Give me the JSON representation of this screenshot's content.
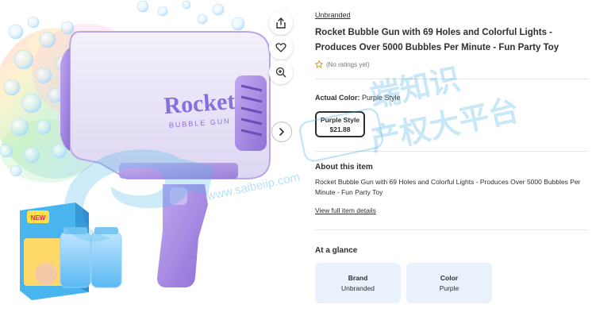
{
  "product": {
    "brand": "Unbranded",
    "title": "Rocket Bubble Gun with 69 Holes and Colorful Lights - Produces Over 5000 Bubbles Per Minute - Fun Party Toy",
    "rating_text": "(No ratings yet)",
    "printed_name": "Rocket",
    "printed_sub": "BUBBLE GUN",
    "box_badge": "NEW"
  },
  "color": {
    "label": "Actual Color:",
    "value": "Purple Style",
    "swatch_name": "Purple Style",
    "swatch_price": "$21.88"
  },
  "about": {
    "heading": "About this item",
    "text": "Rocket Bubble Gun with 69 Holes and Colorful Lights - Produces Over 5000 Bubbles Per Minute - Fun Party Toy",
    "link": "View full item details"
  },
  "glance": {
    "heading": "At a glance",
    "cards": [
      {
        "key": "Brand",
        "value": "Unbranded"
      },
      {
        "key": "Color",
        "value": "Purple"
      }
    ]
  },
  "watermark": {
    "line1": "端知识",
    "line2": "产权大平台",
    "url": "www.saibeiip.com"
  },
  "colors": {
    "text": "#2e2f32",
    "muted": "#74767c",
    "glance_bg": "#e9f1fb",
    "toy_purple": "#a98be0",
    "watermark": "#4fb6e8"
  },
  "icons": [
    "share-icon",
    "heart-icon",
    "zoom-icon",
    "chevron-right-icon",
    "star-icon"
  ]
}
